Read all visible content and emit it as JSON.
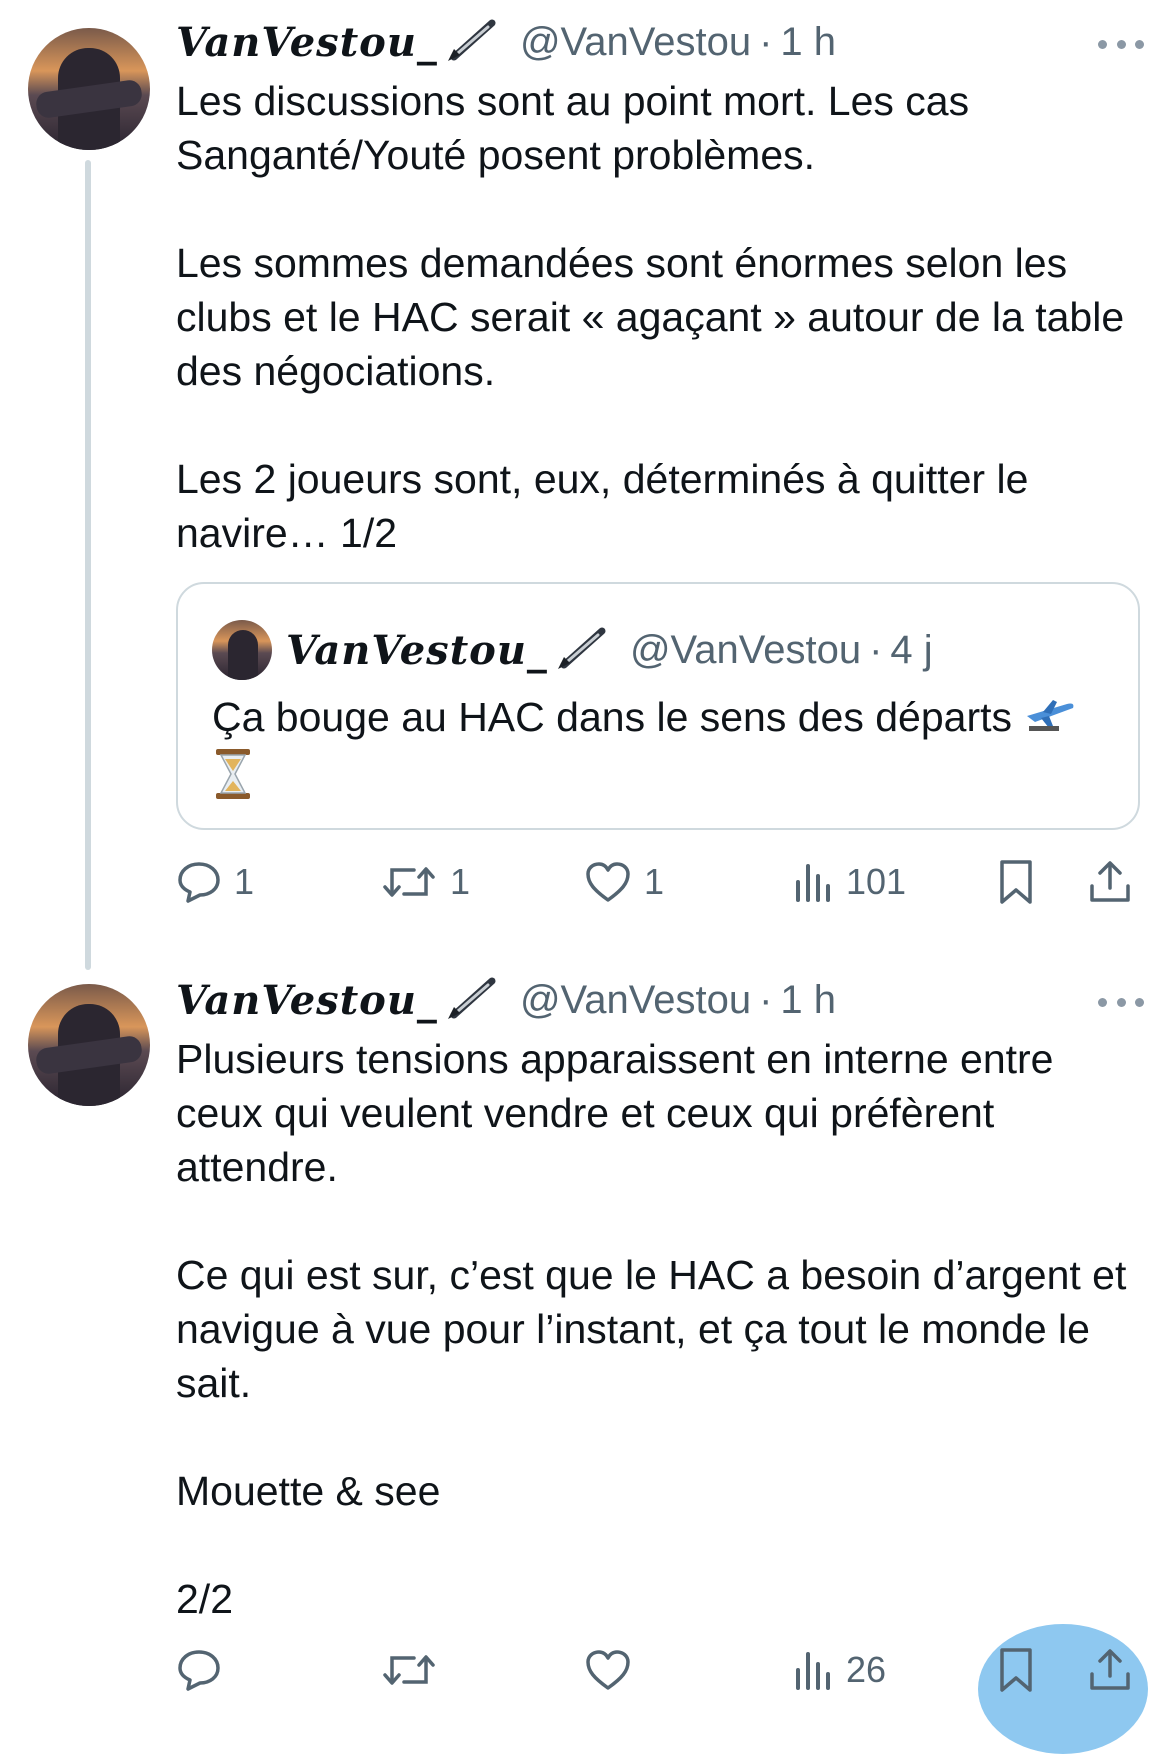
{
  "tweets": [
    {
      "name": "VanVestou_",
      "handle": "@VanVestou",
      "time": "1 h",
      "paragraphs": [
        "Les discussions sont au point mort. Les cas Sanganté/Youté posent problèmes.",
        "Les sommes demandées sont énormes selon les clubs et le HAC serait « agaçant » autour de la table des négociations.",
        "Les 2 joueurs sont, eux, déterminés à quitter le navire… 1/2"
      ],
      "quote": {
        "name": "VanVestou_",
        "handle": "@VanVestou",
        "time": "4 j",
        "text": "Ça bouge au HAC dans le sens des départs "
      },
      "actions": {
        "reply_count": "1",
        "retweet_count": "1",
        "like_count": "1",
        "views_count": "101"
      }
    },
    {
      "name": "VanVestou_",
      "handle": "@VanVestou",
      "time": "1 h",
      "paragraphs": [
        "Plusieurs tensions apparaissent en interne entre ceux qui veulent vendre et ceux qui préfèrent attendre.",
        "Ce qui est sur, c’est que le HAC a besoin d’argent et navigue à vue pour l’instant, et ça tout le monde le sait.",
        "Mouette & see",
        "2/2"
      ],
      "actions": {
        "views_count": "26"
      }
    }
  ],
  "separator": "·",
  "icons": {
    "pen": "fountain-pen-icon",
    "more": "more-dots-icon",
    "reply": "reply-icon",
    "retweet": "retweet-icon",
    "like": "heart-icon",
    "views": "views-chart-icon",
    "bookmark": "bookmark-icon",
    "share": "share-icon",
    "airplane": "airplane-emoji",
    "hourglass": "hourglass-emoji"
  },
  "colors": {
    "text": "#0f1419",
    "secondary": "#536471",
    "border": "#cfd9de",
    "share_highlight": "#8ec8f0"
  }
}
